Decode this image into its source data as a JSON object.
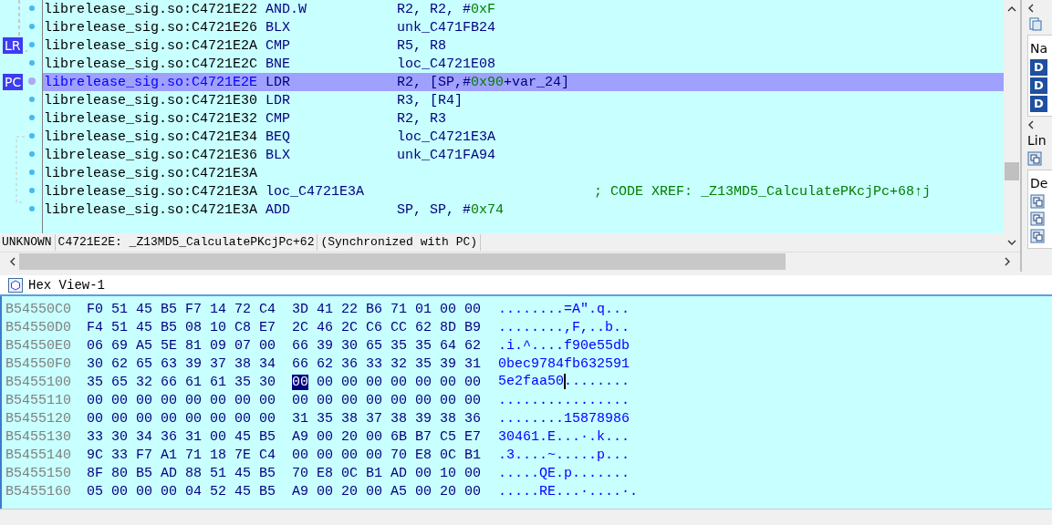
{
  "disasm": {
    "lines": [
      {
        "address": "librelease_sig.so:C4721E22",
        "mnemonic": "AND.W",
        "operands": [
          {
            "t": "R2, R2, #",
            "kind": "plain"
          },
          {
            "t": "0xF",
            "kind": "number"
          }
        ],
        "highlighted": false
      },
      {
        "address": "librelease_sig.so:C4721E26",
        "mnemonic": "BLX",
        "operands": [
          {
            "t": "unk_C471FB24",
            "kind": "plain"
          }
        ],
        "highlighted": false
      },
      {
        "address": "librelease_sig.so:C4721E2A",
        "mnemonic": "CMP",
        "operands": [
          {
            "t": "R5, R8",
            "kind": "plain"
          }
        ],
        "marker": "LR",
        "highlighted": false
      },
      {
        "address": "librelease_sig.so:C4721E2C",
        "mnemonic": "BNE",
        "operands": [
          {
            "t": "loc_C4721E08",
            "kind": "plain"
          }
        ],
        "highlighted": false
      },
      {
        "address": "librelease_sig.so:C4721E2E",
        "mnemonic": "LDR",
        "operands": [
          {
            "t": "R2, [SP,#",
            "kind": "plain"
          },
          {
            "t": "0x90",
            "kind": "number"
          },
          {
            "t": "+var_24]",
            "kind": "plain"
          }
        ],
        "marker": "PC",
        "highlighted": true
      },
      {
        "address": "librelease_sig.so:C4721E30",
        "mnemonic": "LDR",
        "operands": [
          {
            "t": "R3, [R4]",
            "kind": "plain"
          }
        ],
        "highlighted": false
      },
      {
        "address": "librelease_sig.so:C4721E32",
        "mnemonic": "CMP",
        "operands": [
          {
            "t": "R2, R3",
            "kind": "plain"
          }
        ],
        "highlighted": false
      },
      {
        "address": "librelease_sig.so:C4721E34",
        "mnemonic": "BEQ",
        "operands": [
          {
            "t": "loc_C4721E3A",
            "kind": "plain"
          }
        ],
        "highlighted": false
      },
      {
        "address": "librelease_sig.so:C4721E36",
        "mnemonic": "BLX",
        "operands": [
          {
            "t": "unk_C471FA94",
            "kind": "plain"
          }
        ],
        "highlighted": false
      },
      {
        "address": "librelease_sig.so:C4721E3A",
        "highlighted": false
      },
      {
        "address": "librelease_sig.so:C4721E3A",
        "mnemonic": "loc_C4721E3A",
        "comment": "; CODE XREF: _Z13MD5_CalculatePKcjPc+68↑j",
        "highlighted": false
      },
      {
        "address": "librelease_sig.so:C4721E3A",
        "mnemonic": "ADD",
        "operands": [
          {
            "t": "SP, SP, #",
            "kind": "plain"
          },
          {
            "t": "0x74",
            "kind": "number"
          }
        ],
        "highlighted": false
      }
    ],
    "status": [
      "UNKNOWN",
      "C4721E2E: _Z13MD5_CalculatePKcjPc+62",
      "(Synchronized with PC)"
    ]
  },
  "side_panel": {
    "header": "Na",
    "rows": [
      "D",
      "D",
      "D"
    ],
    "label": "Lin",
    "section": "De"
  },
  "hex_view": {
    "title": "Hex View-1",
    "rows": [
      {
        "address": "B54550C0",
        "bytes": [
          {
            "b": "F0",
            "selected": false
          },
          {
            "b": "51",
            "selected": false
          },
          {
            "b": "45",
            "selected": false
          },
          {
            "b": "B5",
            "selected": false
          },
          {
            "b": "F7",
            "selected": false
          },
          {
            "b": "14",
            "selected": false
          },
          {
            "b": "72",
            "selected": false
          },
          {
            "b": "C4",
            "selected": false
          },
          {
            "b": "3D",
            "selected": false
          },
          {
            "b": "41",
            "selected": false
          },
          {
            "b": "22",
            "selected": false
          },
          {
            "b": "B6",
            "selected": false
          },
          {
            "b": "71",
            "selected": false
          },
          {
            "b": "01",
            "selected": false
          },
          {
            "b": "00",
            "selected": false
          },
          {
            "b": "00",
            "selected": false
          }
        ],
        "ascii": "........=A\".q..."
      },
      {
        "address": "B54550D0",
        "bytes": [
          {
            "b": "F4",
            "selected": false
          },
          {
            "b": "51",
            "selected": false
          },
          {
            "b": "45",
            "selected": false
          },
          {
            "b": "B5",
            "selected": false
          },
          {
            "b": "08",
            "selected": false
          },
          {
            "b": "10",
            "selected": false
          },
          {
            "b": "C8",
            "selected": false
          },
          {
            "b": "E7",
            "selected": false
          },
          {
            "b": "2C",
            "selected": false
          },
          {
            "b": "46",
            "selected": false
          },
          {
            "b": "2C",
            "selected": false
          },
          {
            "b": "C6",
            "selected": false
          },
          {
            "b": "CC",
            "selected": false
          },
          {
            "b": "62",
            "selected": false
          },
          {
            "b": "8D",
            "selected": false
          },
          {
            "b": "B9",
            "selected": false
          }
        ],
        "ascii": "........,F,..b.."
      },
      {
        "address": "B54550E0",
        "bytes": [
          {
            "b": "06",
            "selected": false
          },
          {
            "b": "69",
            "selected": false
          },
          {
            "b": "A5",
            "selected": false
          },
          {
            "b": "5E",
            "selected": false
          },
          {
            "b": "81",
            "selected": false
          },
          {
            "b": "09",
            "selected": false
          },
          {
            "b": "07",
            "selected": false
          },
          {
            "b": "00",
            "selected": false
          },
          {
            "b": "66",
            "selected": false
          },
          {
            "b": "39",
            "selected": false
          },
          {
            "b": "30",
            "selected": false
          },
          {
            "b": "65",
            "selected": false
          },
          {
            "b": "35",
            "selected": false
          },
          {
            "b": "35",
            "selected": false
          },
          {
            "b": "64",
            "selected": false
          },
          {
            "b": "62",
            "selected": false
          }
        ],
        "ascii": ".i.^....f90e55db"
      },
      {
        "address": "B54550F0",
        "bytes": [
          {
            "b": "30",
            "selected": false
          },
          {
            "b": "62",
            "selected": false
          },
          {
            "b": "65",
            "selected": false
          },
          {
            "b": "63",
            "selected": false
          },
          {
            "b": "39",
            "selected": false
          },
          {
            "b": "37",
            "selected": false
          },
          {
            "b": "38",
            "selected": false
          },
          {
            "b": "34",
            "selected": false
          },
          {
            "b": "66",
            "selected": false
          },
          {
            "b": "62",
            "selected": false
          },
          {
            "b": "36",
            "selected": false
          },
          {
            "b": "33",
            "selected": false
          },
          {
            "b": "32",
            "selected": false
          },
          {
            "b": "35",
            "selected": false
          },
          {
            "b": "39",
            "selected": false
          },
          {
            "b": "31",
            "selected": false
          }
        ],
        "ascii": "0bec9784fb632591"
      },
      {
        "address": "B5455100",
        "bytes": [
          {
            "b": "35",
            "selected": false
          },
          {
            "b": "65",
            "selected": false
          },
          {
            "b": "32",
            "selected": false
          },
          {
            "b": "66",
            "selected": false
          },
          {
            "b": "61",
            "selected": false
          },
          {
            "b": "61",
            "selected": false
          },
          {
            "b": "35",
            "selected": false
          },
          {
            "b": "30",
            "selected": false
          },
          {
            "b": "00",
            "selected": true
          },
          {
            "b": "00",
            "selected": false
          },
          {
            "b": "00",
            "selected": false
          },
          {
            "b": "00",
            "selected": false
          },
          {
            "b": "00",
            "selected": false
          },
          {
            "b": "00",
            "selected": false
          },
          {
            "b": "00",
            "selected": false
          },
          {
            "b": "00",
            "selected": false
          }
        ],
        "ascii": "5e2faa50........"
      },
      {
        "address": "B5455110",
        "bytes": [
          {
            "b": "00",
            "selected": false
          },
          {
            "b": "00",
            "selected": false
          },
          {
            "b": "00",
            "selected": false
          },
          {
            "b": "00",
            "selected": false
          },
          {
            "b": "00",
            "selected": false
          },
          {
            "b": "00",
            "selected": false
          },
          {
            "b": "00",
            "selected": false
          },
          {
            "b": "00",
            "selected": false
          },
          {
            "b": "00",
            "selected": false
          },
          {
            "b": "00",
            "selected": false
          },
          {
            "b": "00",
            "selected": false
          },
          {
            "b": "00",
            "selected": false
          },
          {
            "b": "00",
            "selected": false
          },
          {
            "b": "00",
            "selected": false
          },
          {
            "b": "00",
            "selected": false
          },
          {
            "b": "00",
            "selected": false
          }
        ],
        "ascii": "................"
      },
      {
        "address": "B5455120",
        "bytes": [
          {
            "b": "00",
            "selected": false
          },
          {
            "b": "00",
            "selected": false
          },
          {
            "b": "00",
            "selected": false
          },
          {
            "b": "00",
            "selected": false
          },
          {
            "b": "00",
            "selected": false
          },
          {
            "b": "00",
            "selected": false
          },
          {
            "b": "00",
            "selected": false
          },
          {
            "b": "00",
            "selected": false
          },
          {
            "b": "31",
            "selected": false
          },
          {
            "b": "35",
            "selected": false
          },
          {
            "b": "38",
            "selected": false
          },
          {
            "b": "37",
            "selected": false
          },
          {
            "b": "38",
            "selected": false
          },
          {
            "b": "39",
            "selected": false
          },
          {
            "b": "38",
            "selected": false
          },
          {
            "b": "36",
            "selected": false
          }
        ],
        "ascii": "........15878986"
      },
      {
        "address": "B5455130",
        "bytes": [
          {
            "b": "33",
            "selected": false
          },
          {
            "b": "30",
            "selected": false
          },
          {
            "b": "34",
            "selected": false
          },
          {
            "b": "36",
            "selected": false
          },
          {
            "b": "31",
            "selected": false
          },
          {
            "b": "00",
            "selected": false
          },
          {
            "b": "45",
            "selected": false
          },
          {
            "b": "B5",
            "selected": false
          },
          {
            "b": "A9",
            "selected": false
          },
          {
            "b": "00",
            "selected": false
          },
          {
            "b": "20",
            "selected": false
          },
          {
            "b": "00",
            "selected": false
          },
          {
            "b": "6B",
            "selected": false
          },
          {
            "b": "B7",
            "selected": false
          },
          {
            "b": "C5",
            "selected": false
          },
          {
            "b": "E7",
            "selected": false
          }
        ],
        "ascii": "30461.E...·.k..."
      },
      {
        "address": "B5455140",
        "bytes": [
          {
            "b": "9C",
            "selected": false
          },
          {
            "b": "33",
            "selected": false
          },
          {
            "b": "F7",
            "selected": false
          },
          {
            "b": "A1",
            "selected": false
          },
          {
            "b": "71",
            "selected": false
          },
          {
            "b": "18",
            "selected": false
          },
          {
            "b": "7E",
            "selected": false
          },
          {
            "b": "C4",
            "selected": false
          },
          {
            "b": "00",
            "selected": false
          },
          {
            "b": "00",
            "selected": false
          },
          {
            "b": "00",
            "selected": false
          },
          {
            "b": "00",
            "selected": false
          },
          {
            "b": "70",
            "selected": false
          },
          {
            "b": "E8",
            "selected": false
          },
          {
            "b": "0C",
            "selected": false
          },
          {
            "b": "B1",
            "selected": false
          }
        ],
        "ascii": ".3....~.....p..."
      },
      {
        "address": "B5455150",
        "bytes": [
          {
            "b": "8F",
            "selected": false
          },
          {
            "b": "80",
            "selected": false
          },
          {
            "b": "B5",
            "selected": false
          },
          {
            "b": "AD",
            "selected": false
          },
          {
            "b": "88",
            "selected": false
          },
          {
            "b": "51",
            "selected": false
          },
          {
            "b": "45",
            "selected": false
          },
          {
            "b": "B5",
            "selected": false
          },
          {
            "b": "70",
            "selected": false
          },
          {
            "b": "E8",
            "selected": false
          },
          {
            "b": "0C",
            "selected": false
          },
          {
            "b": "B1",
            "selected": false
          },
          {
            "b": "AD",
            "selected": false
          },
          {
            "b": "00",
            "selected": false
          },
          {
            "b": "10",
            "selected": false
          },
          {
            "b": "00",
            "selected": false
          }
        ],
        "ascii": ".....QE.p......."
      },
      {
        "address": "B5455160",
        "bytes": [
          {
            "b": "05",
            "selected": false
          },
          {
            "b": "00",
            "selected": false
          },
          {
            "b": "00",
            "selected": false
          },
          {
            "b": "00",
            "selected": false
          },
          {
            "b": "04",
            "selected": false
          },
          {
            "b": "52",
            "selected": false
          },
          {
            "b": "45",
            "selected": false
          },
          {
            "b": "B5",
            "selected": false
          },
          {
            "b": "A9",
            "selected": false
          },
          {
            "b": "00",
            "selected": false
          },
          {
            "b": "20",
            "selected": false
          },
          {
            "b": "00",
            "selected": false
          },
          {
            "b": "A5",
            "selected": false
          },
          {
            "b": "00",
            "selected": false
          },
          {
            "b": "20",
            "selected": false
          },
          {
            "b": "00",
            "selected": false
          }
        ],
        "ascii": ".....RE...·....·."
      }
    ]
  }
}
